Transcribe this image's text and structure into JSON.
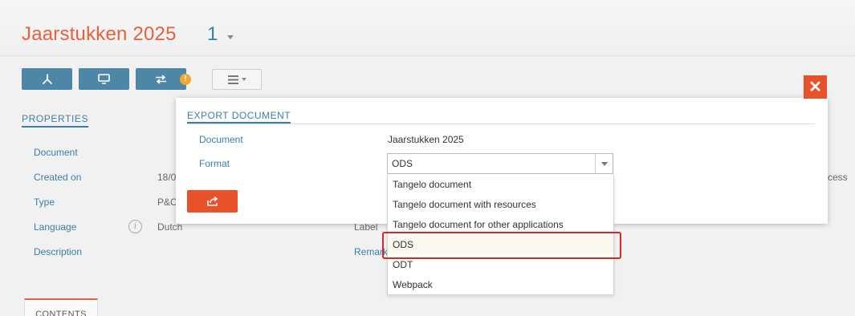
{
  "header": {
    "title": "Jaarstukken 2025",
    "version": "1"
  },
  "toolbar": {
    "buttons": [
      {
        "icon": "pdf-icon"
      },
      {
        "icon": "monitor-icon"
      },
      {
        "icon": "transfer-icon"
      }
    ],
    "warning_mark": "!",
    "menu_icon": "menu-icon"
  },
  "properties": {
    "section_label": "PROPERTIES",
    "document_label": "Document",
    "created_label": "Created on",
    "created_value": "18/0",
    "type_label": "Type",
    "type_value": "P&C",
    "language_label": "Language",
    "language_value": "Dutch",
    "description_label": "Description",
    "label_label": "Label",
    "remark_label": "Remark",
    "right_fragment": "cess"
  },
  "info_mark": "i",
  "contents_tab": "CONTENTS",
  "dialog": {
    "title": "EXPORT DOCUMENT",
    "document_label": "Document",
    "document_value": "Jaarstukken 2025",
    "format_label": "Format",
    "format_value": "ODS",
    "close_mark": "✕",
    "options": [
      "Tangelo document",
      "Tangelo document with resources",
      "Tangelo document for other applications",
      "ODS",
      "ODT",
      "Webpack"
    ],
    "selected_index": 3
  },
  "colors": {
    "accent_orange": "#e8603c",
    "accent_blue": "#3d7ea6",
    "toolbar_blue": "#4e86a8",
    "highlight_red": "#d9262b"
  }
}
